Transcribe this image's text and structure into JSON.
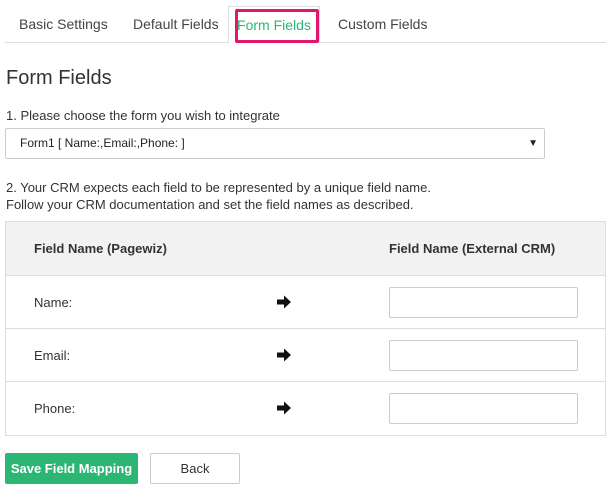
{
  "tabs": [
    {
      "label": "Basic Settings"
    },
    {
      "label": "Default Fields"
    },
    {
      "label": "Form Fields",
      "active": true
    },
    {
      "label": "Custom Fields"
    }
  ],
  "page_title": "Form Fields",
  "step1_text": "1. Please choose the form you wish to integrate",
  "form_select": {
    "value": "Form1 [ Name:,Email:,Phone: ]",
    "caret": "▼"
  },
  "step2_line1": "2. Your CRM expects each field to be represented by a unique field name.",
  "step2_line2": "Follow your CRM documentation and set the field names as described.",
  "table": {
    "col_pagewiz": "Field Name (Pagewiz)",
    "col_crm": "Field Name (External CRM)",
    "rows": [
      {
        "label": "Name:",
        "value": ""
      },
      {
        "label": "Email:",
        "value": ""
      },
      {
        "label": "Phone:",
        "value": ""
      }
    ]
  },
  "buttons": {
    "save": "Save Field Mapping",
    "back": "Back"
  },
  "colors": {
    "accent_green": "#2bb673",
    "highlight_pink": "#e0176a"
  },
  "icons": {
    "row_arrow": "arrow-right-icon",
    "select_caret": "caret-down-icon"
  }
}
